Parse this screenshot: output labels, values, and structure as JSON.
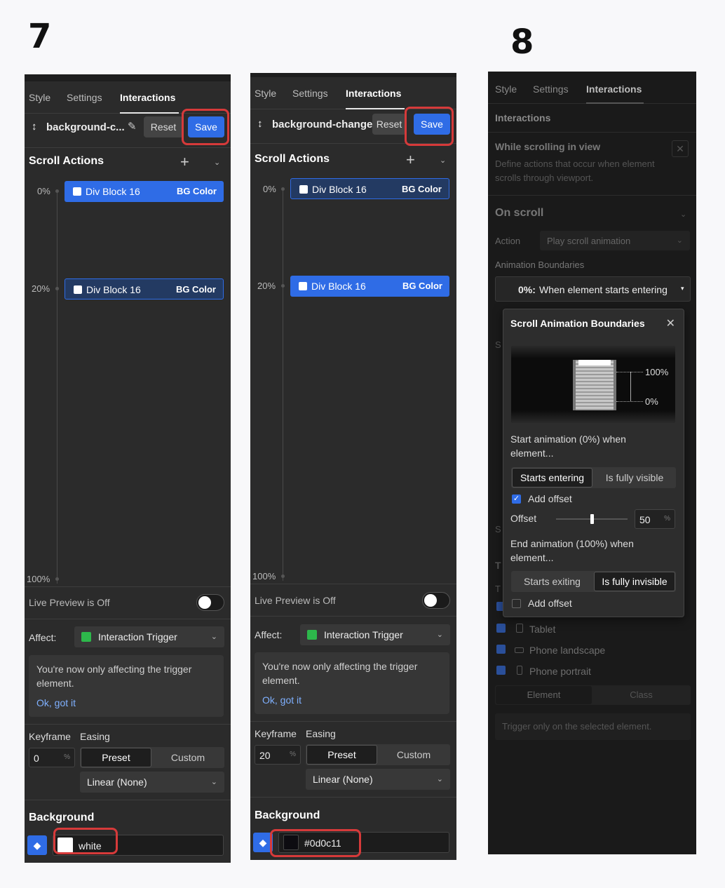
{
  "steps": {
    "a": "7",
    "b": "8"
  },
  "colors": {
    "accent": "#2f6ce6",
    "highlight": "#d63a3a",
    "panel_bg": "#2b2b2b",
    "trigger_green": "#2db84b"
  },
  "panel_a": {
    "tabs": [
      "Style",
      "Settings",
      "Interactions"
    ],
    "interaction_name": "background-c...",
    "reset_label": "Reset",
    "save_label": "Save",
    "scroll_actions_title": "Scroll Actions",
    "keyframes": [
      {
        "pct": "0%",
        "target": "Div Block 16",
        "action": "BG Color"
      },
      {
        "pct": "20%",
        "target": "Div Block 16",
        "action": "BG Color"
      }
    ],
    "end_pct": "100%",
    "live_preview": "Live Preview is Off",
    "affect_label": "Affect:",
    "affect_value": "Interaction Trigger",
    "notice_text": "You're now only affecting the trigger element.",
    "notice_link": "Ok, got it",
    "keyframe_label": "Keyframe",
    "easing_label": "Easing",
    "keyframe_value": "0",
    "keyframe_unit": "%",
    "easing_preset": "Preset",
    "easing_custom": "Custom",
    "easing_value": "Linear (None)",
    "background_title": "Background",
    "background_value": "white",
    "swatch_color": "#ffffff"
  },
  "panel_b": {
    "tabs": [
      "Style",
      "Settings",
      "Interactions"
    ],
    "interaction_name": "background-change",
    "reset_label": "Reset",
    "save_label": "Save",
    "scroll_actions_title": "Scroll Actions",
    "keyframes": [
      {
        "pct": "0%",
        "target": "Div Block 16",
        "action": "BG Color"
      },
      {
        "pct": "20%",
        "target": "Div Block 16",
        "action": "BG Color"
      }
    ],
    "end_pct": "100%",
    "live_preview": "Live Preview is Off",
    "affect_label": "Affect:",
    "affect_value": "Interaction Trigger",
    "notice_text": "You're now only affecting the trigger element.",
    "notice_link": "Ok, got it",
    "keyframe_label": "Keyframe",
    "easing_label": "Easing",
    "keyframe_value": "20",
    "keyframe_unit": "%",
    "easing_preset": "Preset",
    "easing_custom": "Custom",
    "easing_value": "Linear (None)",
    "background_title": "Background",
    "background_value": "#0d0c11",
    "swatch_color": "#0d0c11"
  },
  "panel_c": {
    "tabs": [
      "Style",
      "Settings",
      "Interactions"
    ],
    "interactions_heading": "Interactions",
    "trigger_title": "While scrolling in view",
    "trigger_desc": "Define actions that occur when element scrolls through viewport.",
    "on_scroll": "On scroll",
    "action_label": "Action",
    "action_value": "Play scroll animation",
    "boundaries_label": "Animation Boundaries",
    "boundaries_pct": "0%:",
    "boundaries_value": "When element starts entering",
    "devices": [
      "Tablet",
      "Phone landscape",
      "Phone portrait"
    ],
    "seg_element": "Element",
    "seg_class": "Class",
    "hint": "Trigger only on the selected element.",
    "peek_s1": "S",
    "peek_s2": "S",
    "peek_t": "T",
    "peek_t2": "T"
  },
  "popup": {
    "title": "Scroll Animation Boundaries",
    "viz_top": "100%",
    "viz_bottom": "0%",
    "start_label": "Start animation (0%) when element...",
    "start_options": [
      "Starts entering",
      "Is fully visible"
    ],
    "start_offset_checked": true,
    "add_offset": "Add offset",
    "offset_label": "Offset",
    "offset_value": "50",
    "offset_unit": "%",
    "offset_fraction": 0.5,
    "end_label": "End animation (100%) when element...",
    "end_options": [
      "Starts exiting",
      "Is fully invisible"
    ],
    "end_offset_checked": false
  }
}
